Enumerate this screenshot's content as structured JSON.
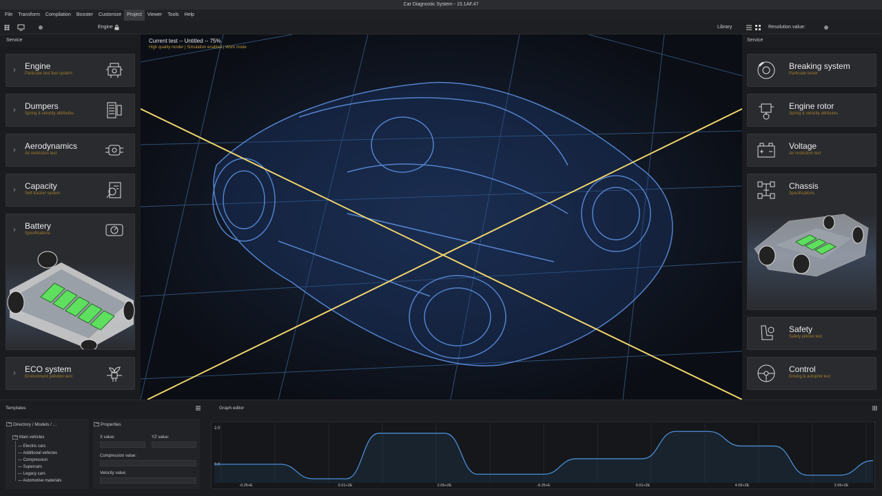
{
  "window_title": "Car Diagnostic System - 15.1AF.47",
  "menu": [
    "File",
    "Transform",
    "Compilation",
    "Booster",
    "Customize",
    "Project",
    "Viewer",
    "Tools",
    "Help"
  ],
  "menu_active": "Project",
  "toolbar": {
    "engine_label": "Engine",
    "library_label": "Library",
    "resolution_label": "Resolution value:"
  },
  "left_panel": {
    "title": "Service",
    "cards": [
      {
        "title": "Engine",
        "subtitle": "Particular test fuel system",
        "icon": "engine-icon"
      },
      {
        "title": "Dumpers",
        "subtitle": "Spring & velocity attributes",
        "icon": "dumper-icon"
      },
      {
        "title": "Aerodynamics",
        "subtitle": "Air restriction test",
        "icon": "aerodynamics-icon"
      },
      {
        "title": "Capacity",
        "subtitle": "Self-tracker system",
        "icon": "capacity-icon"
      },
      {
        "title": "Battery",
        "subtitle": "Specifications",
        "icon": "battery-icon"
      },
      {
        "title": "ECO system",
        "subtitle": "Environment pollution test",
        "icon": "eco-icon"
      }
    ]
  },
  "right_panel": {
    "title": "Service",
    "cards": [
      {
        "title": "Breaking system",
        "subtitle": "Particular tester",
        "icon": "brake-icon"
      },
      {
        "title": "Engine rotor",
        "subtitle": "Spring & velocity attributes",
        "icon": "rotor-icon"
      },
      {
        "title": "Voltage",
        "subtitle": "Air restriction test",
        "icon": "voltage-icon"
      },
      {
        "title": "Chassis",
        "subtitle": "Specifications",
        "icon": "chassis-icon"
      },
      {
        "title": "Safety",
        "subtitle": "Safety pillows test",
        "icon": "seat-icon"
      },
      {
        "title": "Control",
        "subtitle": "Driving & autopilot test",
        "icon": "steering-wheel-icon"
      }
    ]
  },
  "viewport": {
    "title": "Current test -- Untitled -- 75%",
    "subtitle": "High quality render | Simulation enabled | Work mode"
  },
  "bottom": {
    "templates_label": "Templates",
    "directory_label": "Directory / Models / ...",
    "tree_root": "Main vehicles",
    "tree_items": [
      "Electric cars",
      "Additional vehicles",
      "Compression",
      "Supercars",
      "Legacy cars",
      "Automotive materials"
    ],
    "properties_label": "Properties",
    "x_label": "X value:",
    "yz_label": "YZ value:",
    "compression_label": "Compression value:",
    "velocity_label": "Velocity value:",
    "graph_label": "Graph editor"
  },
  "chart_data": {
    "type": "line",
    "y_ticks": [
      "2.0",
      "0.0"
    ],
    "x_ticks": [
      "-0.25+E",
      "0.01+2E",
      "2.05+2E",
      "-0.25+E",
      "0.01+2E",
      "4.05+2E",
      "2.05+2E"
    ],
    "ylim": [
      -0.8,
      2.0
    ],
    "series": [
      {
        "values": [
          0.0,
          0.0,
          0.0,
          -0.8,
          -0.8,
          1.7,
          1.7,
          1.7,
          -0.55,
          -0.55,
          -0.55,
          0.3,
          0.3,
          0.3,
          1.8,
          1.8,
          1.0,
          1.0,
          -0.6,
          -0.6,
          0.2
        ]
      }
    ]
  },
  "colors": {
    "accent": "#4a8fd4",
    "subtitle": "#a07f2a",
    "crosshair": "#f2d66b",
    "battery": "#5ee05e"
  }
}
